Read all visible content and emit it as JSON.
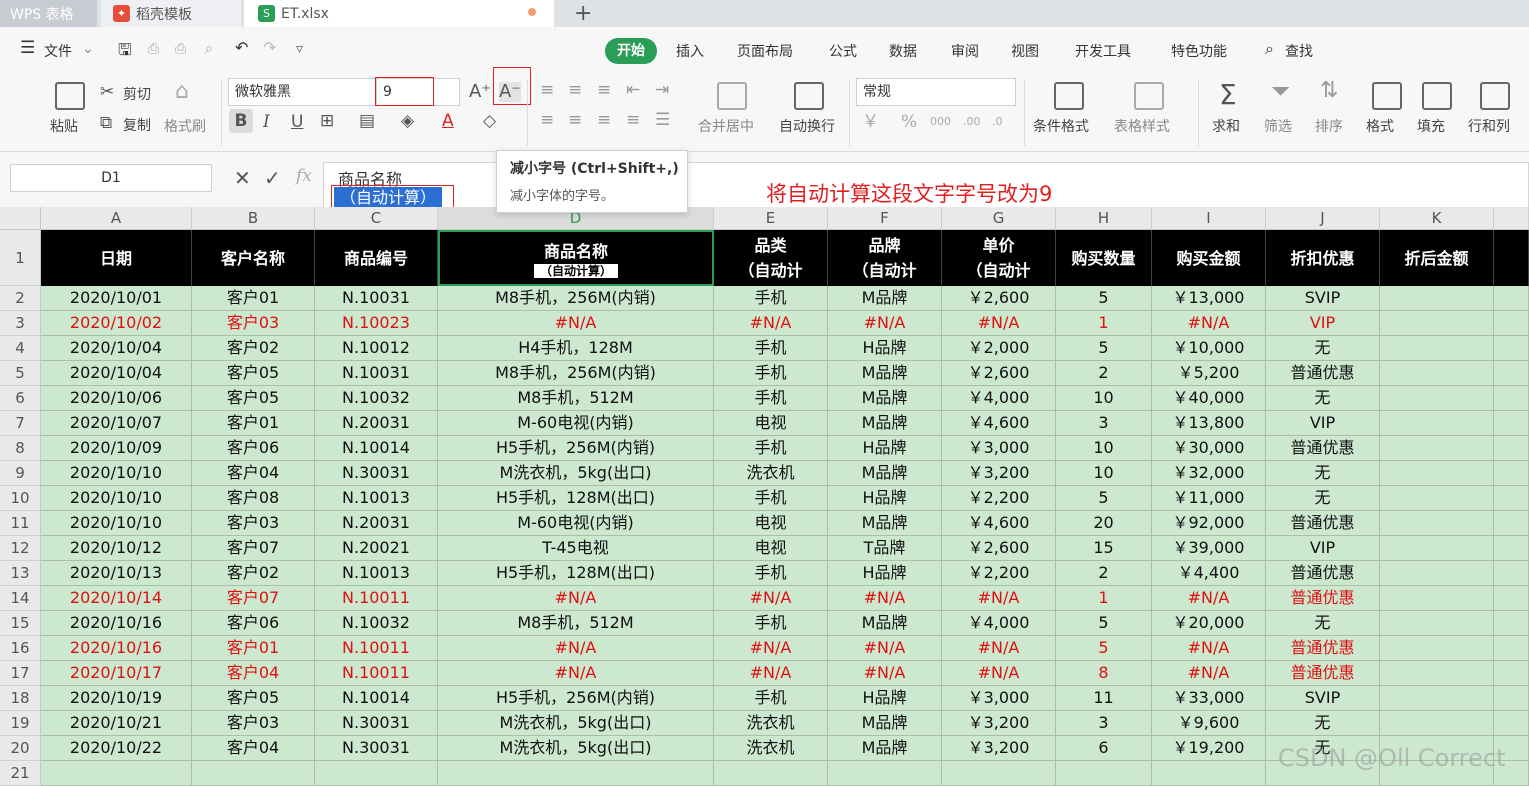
{
  "tabs": {
    "wps": "WPS 表格",
    "daoke": "稻壳模板",
    "file": "ET.xlsx",
    "add": "+"
  },
  "menu": {
    "file": "文件",
    "items": [
      "开始",
      "插入",
      "页面布局",
      "公式",
      "数据",
      "审阅",
      "视图",
      "开发工具",
      "特色功能"
    ],
    "search": "查找"
  },
  "ribbon": {
    "paste": "粘贴",
    "cut": "剪切",
    "copy": "复制",
    "format_painter": "格式刷",
    "font_name": "微软雅黑",
    "font_size": "9",
    "merge_center": "合并居中",
    "wrap": "自动换行",
    "number_format": "常规",
    "cond_format": "条件格式",
    "table_style": "表格样式",
    "sum": "求和",
    "filter": "筛选",
    "sort": "排序",
    "format": "格式",
    "fill": "填充",
    "row_col": "行和列"
  },
  "formula": {
    "name_box": "D1",
    "fx": "fx",
    "line1": "商品名称",
    "line2": "（自动计算）"
  },
  "tooltip": {
    "title": "减小字号 (Ctrl+Shift+,)",
    "body": "减小字体的字号。"
  },
  "annotation": "将自动计算这段文字字号改为9",
  "columns": [
    "A",
    "B",
    "C",
    "D",
    "E",
    "F",
    "G",
    "H",
    "I",
    "J",
    "K"
  ],
  "header": {
    "date": "日期",
    "customer": "客户名称",
    "code": "商品编号",
    "name": "商品名称",
    "name_sub": "（自动计算）",
    "cat": "品类",
    "cat_sub": "（自动计",
    "brand": "品牌",
    "brand_sub": "（自动计",
    "price": "单价",
    "price_sub": "（自动计",
    "qty": "购买数量",
    "amount": "购买金额",
    "discount": "折扣优惠",
    "final": "折后金额"
  },
  "rows": [
    {
      "n": "2",
      "c": [
        "2020/10/01",
        "客户01",
        "N.10031",
        "M8手机，256M(内销)",
        "手机",
        "M品牌",
        "￥2,600",
        "5",
        "￥13,000",
        "SVIP",
        ""
      ],
      "red": false
    },
    {
      "n": "3",
      "c": [
        "2020/10/02",
        "客户03",
        "N.10023",
        "#N/A",
        "#N/A",
        "#N/A",
        "#N/A",
        "1",
        "#N/A",
        "VIP",
        ""
      ],
      "red": true
    },
    {
      "n": "4",
      "c": [
        "2020/10/04",
        "客户02",
        "N.10012",
        "H4手机，128M",
        "手机",
        "H品牌",
        "￥2,000",
        "5",
        "￥10,000",
        "无",
        ""
      ],
      "red": false
    },
    {
      "n": "5",
      "c": [
        "2020/10/04",
        "客户05",
        "N.10031",
        "M8手机，256M(内销)",
        "手机",
        "M品牌",
        "￥2,600",
        "2",
        "￥5,200",
        "普通优惠",
        ""
      ],
      "red": false
    },
    {
      "n": "6",
      "c": [
        "2020/10/06",
        "客户05",
        "N.10032",
        "M8手机，512M",
        "手机",
        "M品牌",
        "￥4,000",
        "10",
        "￥40,000",
        "无",
        ""
      ],
      "red": false
    },
    {
      "n": "7",
      "c": [
        "2020/10/07",
        "客户01",
        "N.20031",
        "M-60电视(内销)",
        "电视",
        "M品牌",
        "￥4,600",
        "3",
        "￥13,800",
        "VIP",
        ""
      ],
      "red": false
    },
    {
      "n": "8",
      "c": [
        "2020/10/09",
        "客户06",
        "N.10014",
        "H5手机，256M(内销)",
        "手机",
        "H品牌",
        "￥3,000",
        "10",
        "￥30,000",
        "普通优惠",
        ""
      ],
      "red": false
    },
    {
      "n": "9",
      "c": [
        "2020/10/10",
        "客户04",
        "N.30031",
        "M洗衣机，5kg(出口)",
        "洗衣机",
        "M品牌",
        "￥3,200",
        "10",
        "￥32,000",
        "无",
        ""
      ],
      "red": false
    },
    {
      "n": "10",
      "c": [
        "2020/10/10",
        "客户08",
        "N.10013",
        "H5手机，128M(出口)",
        "手机",
        "H品牌",
        "￥2,200",
        "5",
        "￥11,000",
        "无",
        ""
      ],
      "red": false
    },
    {
      "n": "11",
      "c": [
        "2020/10/10",
        "客户03",
        "N.20031",
        "M-60电视(内销)",
        "电视",
        "M品牌",
        "￥4,600",
        "20",
        "￥92,000",
        "普通优惠",
        ""
      ],
      "red": false
    },
    {
      "n": "12",
      "c": [
        "2020/10/12",
        "客户07",
        "N.20021",
        "T-45电视",
        "电视",
        "T品牌",
        "￥2,600",
        "15",
        "￥39,000",
        "VIP",
        ""
      ],
      "red": false
    },
    {
      "n": "13",
      "c": [
        "2020/10/13",
        "客户02",
        "N.10013",
        "H5手机，128M(出口)",
        "手机",
        "H品牌",
        "￥2,200",
        "2",
        "￥4,400",
        "普通优惠",
        ""
      ],
      "red": false
    },
    {
      "n": "14",
      "c": [
        "2020/10/14",
        "客户07",
        "N.10011",
        "#N/A",
        "#N/A",
        "#N/A",
        "#N/A",
        "1",
        "#N/A",
        "普通优惠",
        ""
      ],
      "red": true
    },
    {
      "n": "15",
      "c": [
        "2020/10/16",
        "客户06",
        "N.10032",
        "M8手机，512M",
        "手机",
        "M品牌",
        "￥4,000",
        "5",
        "￥20,000",
        "无",
        ""
      ],
      "red": false
    },
    {
      "n": "16",
      "c": [
        "2020/10/16",
        "客户01",
        "N.10011",
        "#N/A",
        "#N/A",
        "#N/A",
        "#N/A",
        "5",
        "#N/A",
        "普通优惠",
        ""
      ],
      "red": true
    },
    {
      "n": "17",
      "c": [
        "2020/10/17",
        "客户04",
        "N.10011",
        "#N/A",
        "#N/A",
        "#N/A",
        "#N/A",
        "8",
        "#N/A",
        "普通优惠",
        ""
      ],
      "red": true
    },
    {
      "n": "18",
      "c": [
        "2020/10/19",
        "客户05",
        "N.10014",
        "H5手机，256M(内销)",
        "手机",
        "H品牌",
        "￥3,000",
        "11",
        "￥33,000",
        "SVIP",
        ""
      ],
      "red": false
    },
    {
      "n": "19",
      "c": [
        "2020/10/21",
        "客户03",
        "N.30031",
        "M洗衣机，5kg(出口)",
        "洗衣机",
        "M品牌",
        "￥3,200",
        "3",
        "￥9,600",
        "无",
        ""
      ],
      "red": false
    },
    {
      "n": "20",
      "c": [
        "2020/10/22",
        "客户04",
        "N.30031",
        "M洗衣机，5kg(出口)",
        "洗衣机",
        "M品牌",
        "￥3,200",
        "6",
        "￥19,200",
        "无",
        ""
      ],
      "red": false
    },
    {
      "n": "21",
      "c": [
        "",
        "",
        "",
        "",
        "",
        "",
        "",
        "",
        "",
        "",
        ""
      ],
      "red": false
    }
  ],
  "watermark": "CSDN @Oll Correct"
}
